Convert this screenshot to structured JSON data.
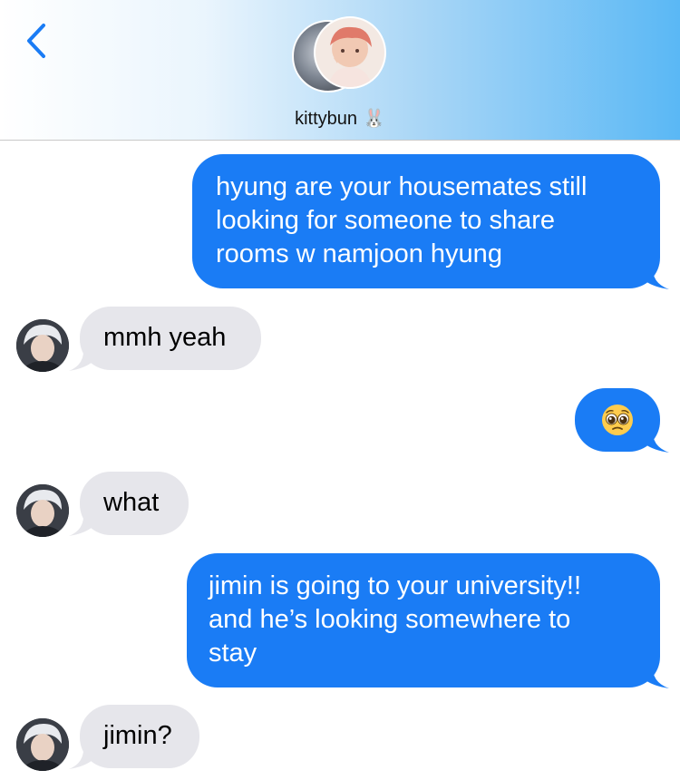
{
  "header": {
    "contact_name": "kittybun",
    "contact_emoji": "🐰",
    "back_icon": "chevron-left-icon"
  },
  "messages": [
    {
      "sender": "me",
      "text": "hyung are your housemates still looking for someone to share rooms w namjoon hyung",
      "lines": [
        "hyung are your housemates still",
        "looking for someone to share",
        "rooms w namjoon hyung"
      ]
    },
    {
      "sender": "contact",
      "text": "mmh yeah"
    },
    {
      "sender": "me",
      "text": "🥺",
      "icon": "pleading-face-icon"
    },
    {
      "sender": "contact",
      "text": "what"
    },
    {
      "sender": "me",
      "text": "jimin is going to your university!! and he’s looking somewhere to stay",
      "lines": [
        "jimin is going to your university!!",
        "and he’s looking somewhere to",
        "stay"
      ]
    },
    {
      "sender": "contact",
      "text": "jimin?"
    }
  ],
  "colors": {
    "sent_bubble": "#1a7cf5",
    "received_bubble": "#e6e6eb",
    "accent": "#1a7cf5",
    "header_gradient_end": "#5ab8f5"
  }
}
